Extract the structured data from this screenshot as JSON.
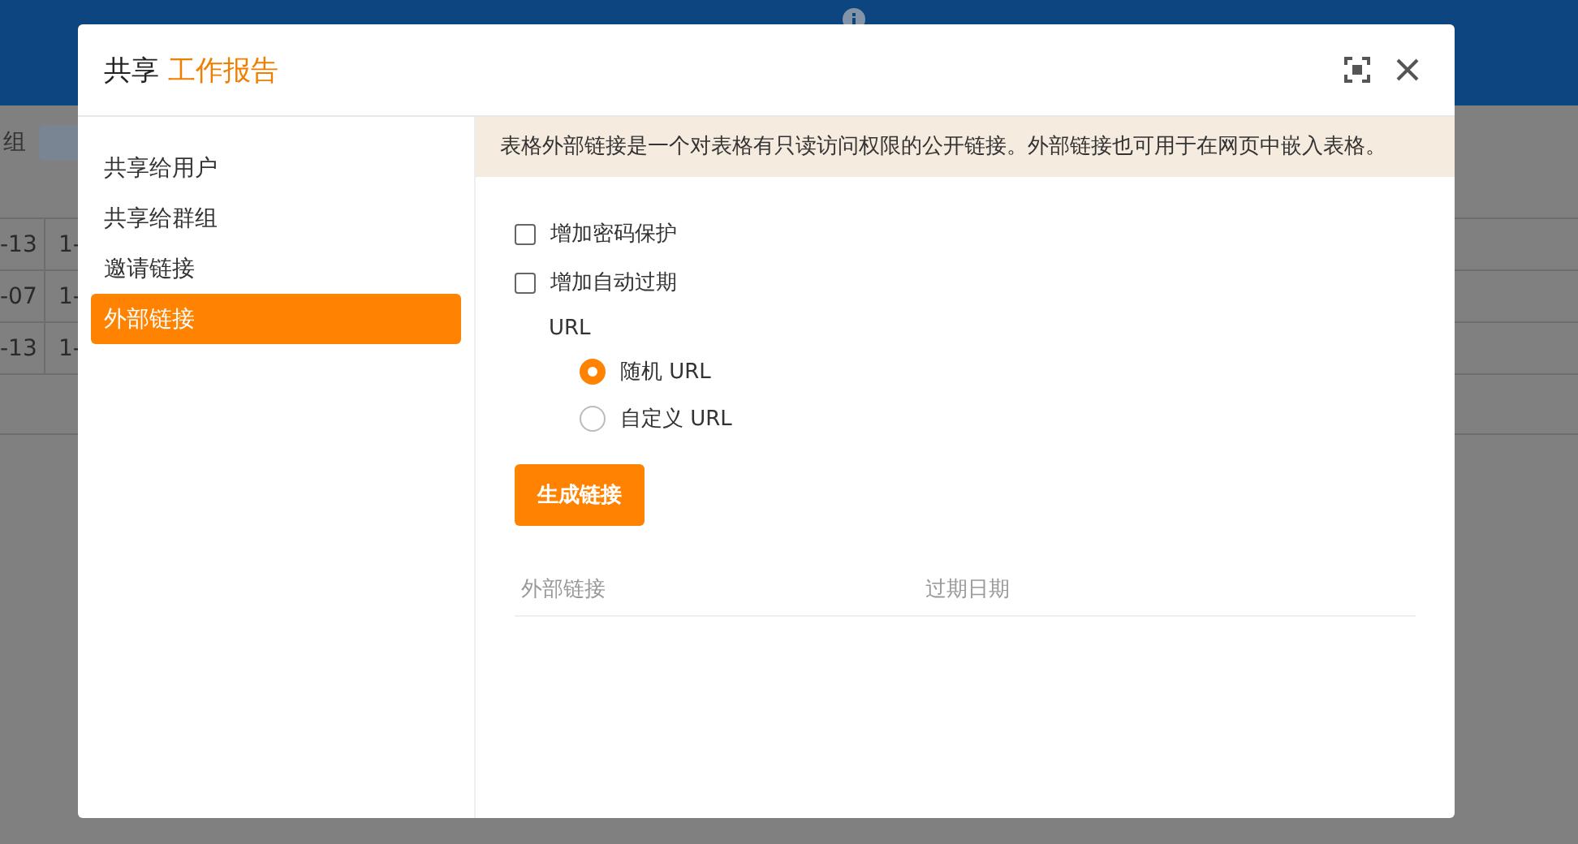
{
  "background": {
    "toolbar_label": "组",
    "table_rows": [
      [
        "-13",
        "1-"
      ],
      [
        "-07",
        "1-"
      ],
      [
        "-13",
        "1-"
      ]
    ]
  },
  "dialog": {
    "title_prefix": "共享",
    "title_name": "工作报告",
    "sidebar": {
      "items": [
        {
          "label": "共享给用户",
          "selected": false
        },
        {
          "label": "共享给群组",
          "selected": false
        },
        {
          "label": "邀请链接",
          "selected": false
        },
        {
          "label": "外部链接",
          "selected": true
        }
      ]
    },
    "notice": "表格外部链接是一个对表格有只读访问权限的公开链接。外部链接也可用于在网页中嵌入表格。",
    "options": [
      {
        "label": "增加密码保护",
        "checked": false
      },
      {
        "label": "增加自动过期",
        "checked": false
      }
    ],
    "url_label": "URL",
    "url_choices": [
      {
        "label": "随机 URL",
        "selected": true
      },
      {
        "label": "自定义 URL",
        "selected": false
      }
    ],
    "generate_button": "生成链接",
    "table": {
      "columns": [
        "外部链接",
        "过期日期"
      ]
    }
  }
}
